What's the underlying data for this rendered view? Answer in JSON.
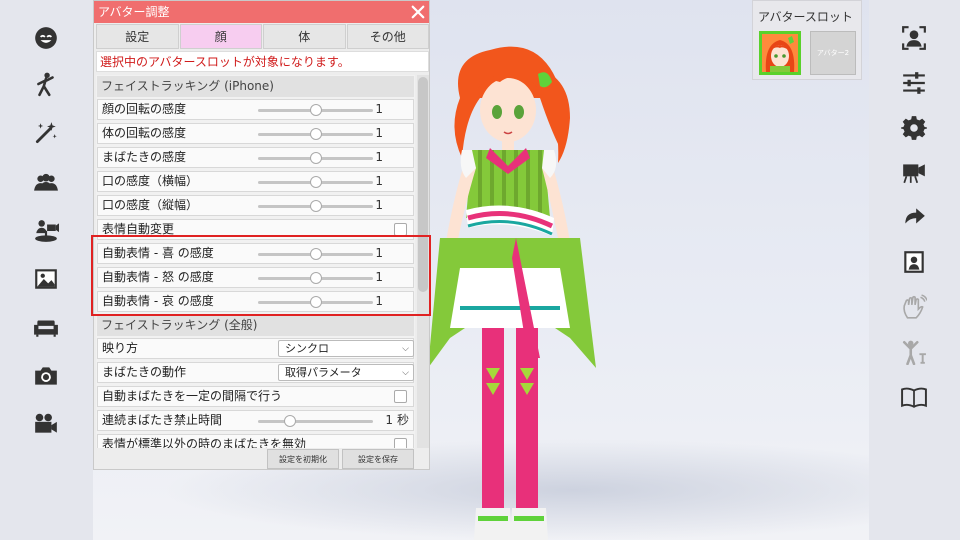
{
  "panel": {
    "title": "アバター調整",
    "tabs": [
      "設定",
      "顔",
      "体",
      "その他"
    ],
    "active_tab": "顔",
    "notice": "選択中のアバタースロットが対象になります。",
    "sections": {
      "iphone": "フェイストラッキング (iPhone)",
      "general": "フェイストラッキング (全般)"
    },
    "rows": {
      "face_rotation": {
        "label": "顔の回転の感度",
        "value": "1"
      },
      "body_rotation": {
        "label": "体の回転の感度",
        "value": "1"
      },
      "blink": {
        "label": "まばたきの感度",
        "value": "1"
      },
      "mouth_width": {
        "label": "口の感度（横幅）",
        "value": "1"
      },
      "mouth_height": {
        "label": "口の感度（縦幅）",
        "value": "1"
      },
      "auto_expression": {
        "label": "表情自動変更"
      },
      "joy": {
        "label": "自動表情 - 喜 の感度",
        "value": "1"
      },
      "anger": {
        "label": "自動表情 - 怒 の感度",
        "value": "1"
      },
      "sorrow": {
        "label": "自動表情 - 哀 の感度",
        "value": "1"
      },
      "display_mode": {
        "label": "映り方",
        "selected": "シンクロ"
      },
      "blink_action": {
        "label": "まばたきの動作",
        "selected": "取得パラメータ"
      },
      "auto_blink": {
        "label": "自動まばたきを一定の間隔で行う"
      },
      "blink_lock": {
        "label": "連続まばたき禁止時間",
        "value": "1",
        "unit": "秒"
      },
      "disable_blink": {
        "label": "表情が標準以外の時のまばたきを無効"
      }
    },
    "slider_levels": {
      "face_rotation": 0.5,
      "body_rotation": 0.5,
      "blink": 0.5,
      "mouth_width": 0.5,
      "mouth_height": 0.5,
      "joy": 0.5,
      "anger": 0.5,
      "sorrow": 0.5,
      "blink_lock": 0.28
    },
    "footer": {
      "reset": "設定を初期化",
      "save": "設定を保存"
    }
  },
  "avatar_slot": {
    "title": "アバタースロット",
    "slot2_label": "アバター2"
  },
  "left_sidebar_icons": [
    "face-icon",
    "motion-icon",
    "magic-wand-icon",
    "people-icon",
    "camera-stand-icon",
    "image-icon",
    "sofa-icon",
    "camera-icon",
    "film-camera-icon"
  ],
  "right_sidebar_icons": [
    "person-frame-icon",
    "sliders-icon",
    "gear-icon",
    "video-camera-icon",
    "redo-icon",
    "portrait-icon",
    "hand-wave-icon",
    "pose-icon",
    "book-icon"
  ],
  "colors": {
    "title_bar": "#f06e6e",
    "active_tab": "#f7cdf0",
    "notice_text": "#d01b1b",
    "highlight": "#e02222",
    "slot_border": "#5ad12b"
  }
}
